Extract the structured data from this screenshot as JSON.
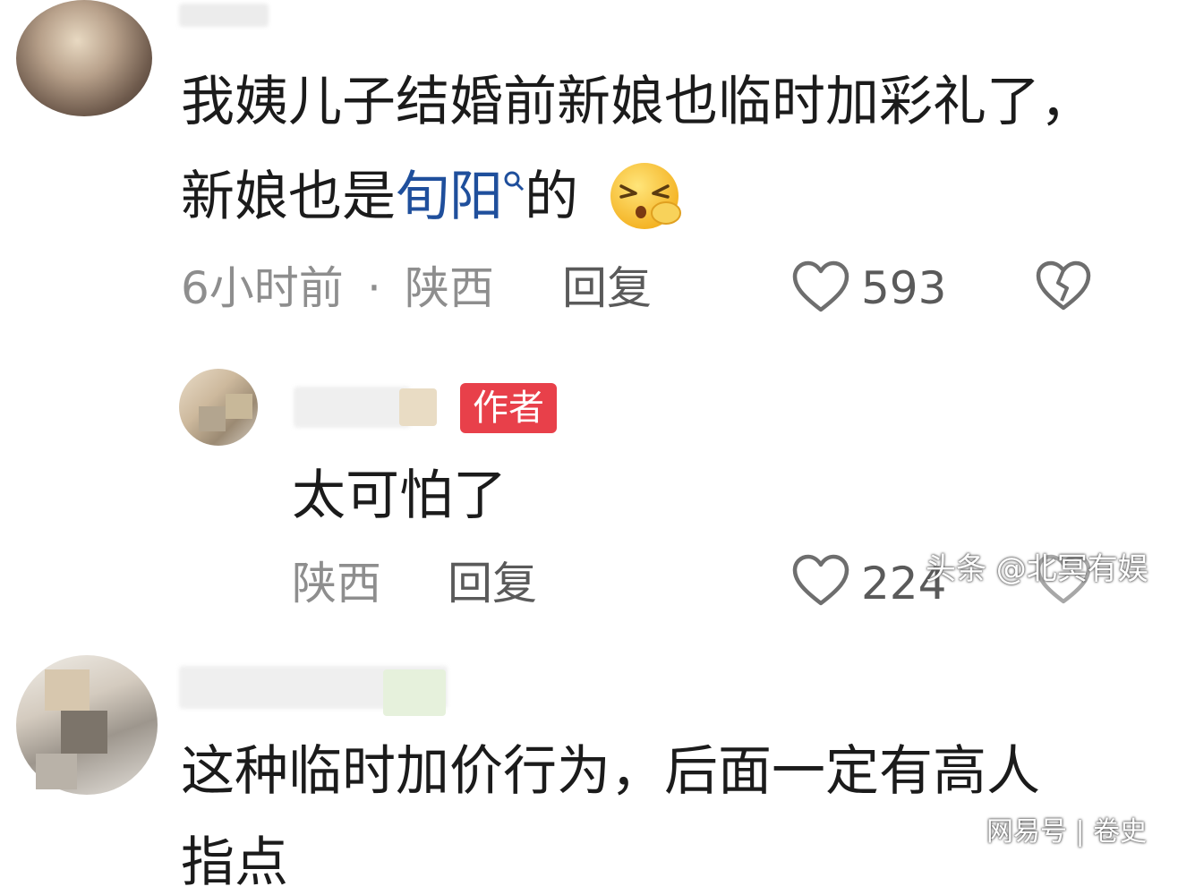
{
  "comments": [
    {
      "text_line1": "我姨儿子结婚前新娘也临时加彩礼了，",
      "text_line2_prefix": "新娘也是",
      "text_line2_link": "旬阳",
      "text_line2_suffix": "的",
      "time": "6小时前",
      "separator": "·",
      "location": "陕西",
      "reply_label": "回复",
      "likes": "593"
    },
    {
      "author_badge": "作者",
      "text": "太可怕了",
      "location": "陕西",
      "reply_label": "回复",
      "likes": "224"
    },
    {
      "text_line1": "这种临时加价行为，后面一定有高人",
      "text_line2": "指点"
    }
  ],
  "watermarks": {
    "toutiao": "头条 @北冥有娱",
    "wangyi": "网易号 | 卷史"
  },
  "icons": {
    "like": "heart-outline-icon",
    "dislike": "broken-heart-icon",
    "search": "search-icon",
    "emoji": "sleepy-emoji-icon"
  }
}
